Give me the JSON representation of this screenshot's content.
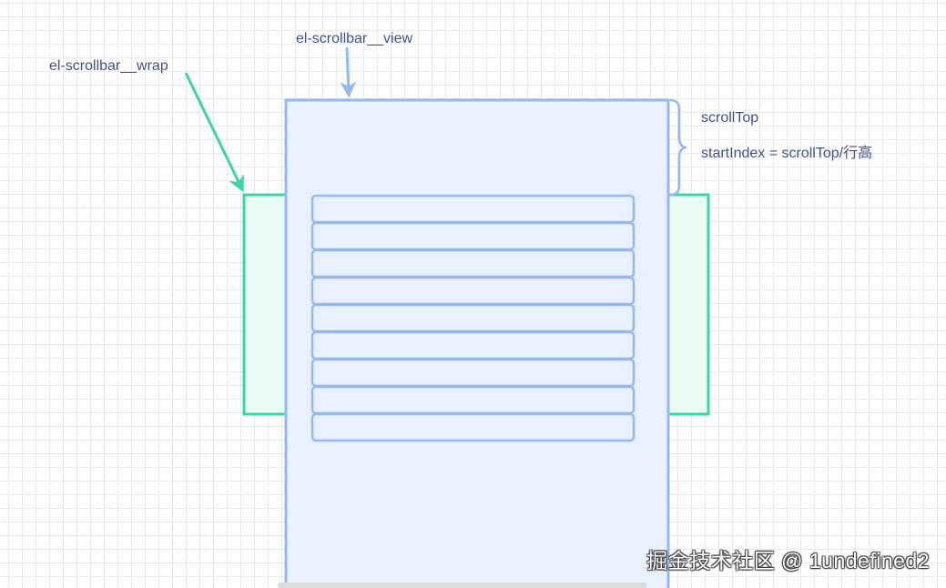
{
  "labels": {
    "view": "el-scrollbar__view",
    "wrap": "el-scrollbar__wrap",
    "scroll_top": "scrollTop",
    "start_index": "startIndex = scrollTop/行高"
  },
  "list": {
    "row_count": 9
  },
  "watermark": "掘金技术社区 @ 1undefined2",
  "colors": {
    "view_stroke": "#93b8f2",
    "view_fill": "#e8f1fd",
    "wrap_stroke": "#3ad6a8",
    "wrap_fill": "#eafdf5",
    "text": "#3f5189"
  }
}
